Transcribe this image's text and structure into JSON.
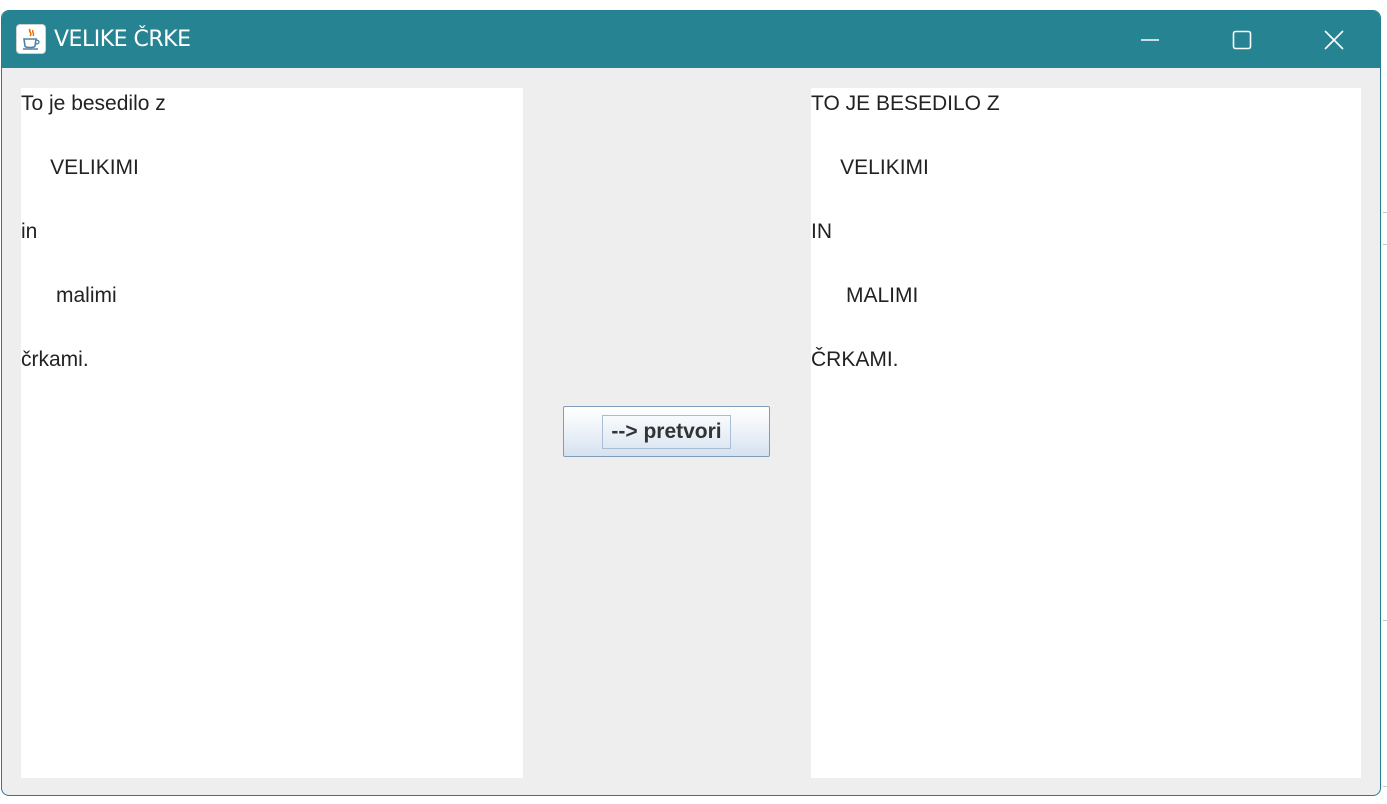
{
  "window": {
    "title": "VELIKE ČRKE",
    "app_icon": "java-coffee-cup-icon",
    "controls": {
      "minimize_icon": "minimize-icon",
      "maximize_icon": "maximize-icon",
      "close_icon": "close-icon"
    },
    "colors": {
      "titlebar": "#258392",
      "body": "#eeeeee"
    }
  },
  "input_text": {
    "lines": [
      "To je besedilo z",
      "",
      "     VELIKIMI",
      "",
      "in",
      "",
      "      malimi",
      "",
      "črkami."
    ]
  },
  "convert_button": {
    "label": "--> pretvori"
  },
  "output_text": {
    "lines": [
      "TO JE BESEDILO Z",
      "",
      "     VELIKIMI",
      "",
      "IN",
      "",
      "      MALIMI",
      "",
      "ČRKAMI."
    ]
  }
}
